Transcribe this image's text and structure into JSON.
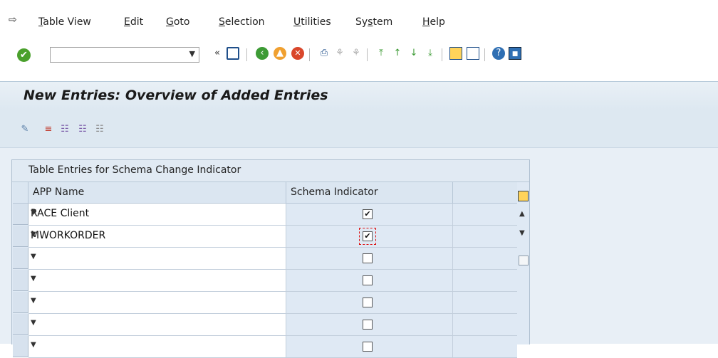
{
  "menubar": {
    "items": [
      {
        "pre": "",
        "u": "T",
        "post": "able View"
      },
      {
        "pre": "",
        "u": "E",
        "post": "dit"
      },
      {
        "pre": "",
        "u": "G",
        "post": "oto"
      },
      {
        "pre": "",
        "u": "S",
        "post": "election"
      },
      {
        "pre": "",
        "u": "U",
        "post": "tilities"
      },
      {
        "pre": "Sy",
        "u": "s",
        "post": "tem"
      },
      {
        "pre": "",
        "u": "H",
        "post": "elp"
      }
    ]
  },
  "toolbar": {
    "command_field_value": "",
    "icons": [
      "enter-icon",
      "command-dropdown-icon",
      "collapse-icon",
      "save-icon",
      "back-icon",
      "exit-icon",
      "cancel-icon",
      "print-icon",
      "find-icon",
      "find-next-icon",
      "first-page-icon",
      "previous-page-icon",
      "next-page-icon",
      "last-page-icon",
      "create-session-icon",
      "shortcut-icon",
      "help-icon",
      "customize-layout-icon"
    ]
  },
  "screen": {
    "title": "New Entries: Overview of Added Entries"
  },
  "app_toolbar": {
    "icons": [
      "change-display-icon",
      "delete-row-icon",
      "select-all-icon",
      "select-block-icon",
      "deselect-all-icon"
    ]
  },
  "table": {
    "caption": "Table Entries for Schema Change Indicator",
    "columns": [
      "APP Name",
      "Schema Indicator"
    ],
    "rows": [
      {
        "app": "RACE Client",
        "indicator": true
      },
      {
        "app": "MWORKORDER",
        "indicator": true,
        "focused": true
      },
      {
        "app": "",
        "indicator": false
      },
      {
        "app": "",
        "indicator": false
      },
      {
        "app": "",
        "indicator": false
      },
      {
        "app": "",
        "indicator": false
      },
      {
        "app": "",
        "indicator": false
      }
    ]
  },
  "colors": {
    "title_bg": "#dde8f1",
    "content_bg": "#e8eff6",
    "ok_green": "#4aa02c",
    "focus_red": "#dd1111"
  }
}
